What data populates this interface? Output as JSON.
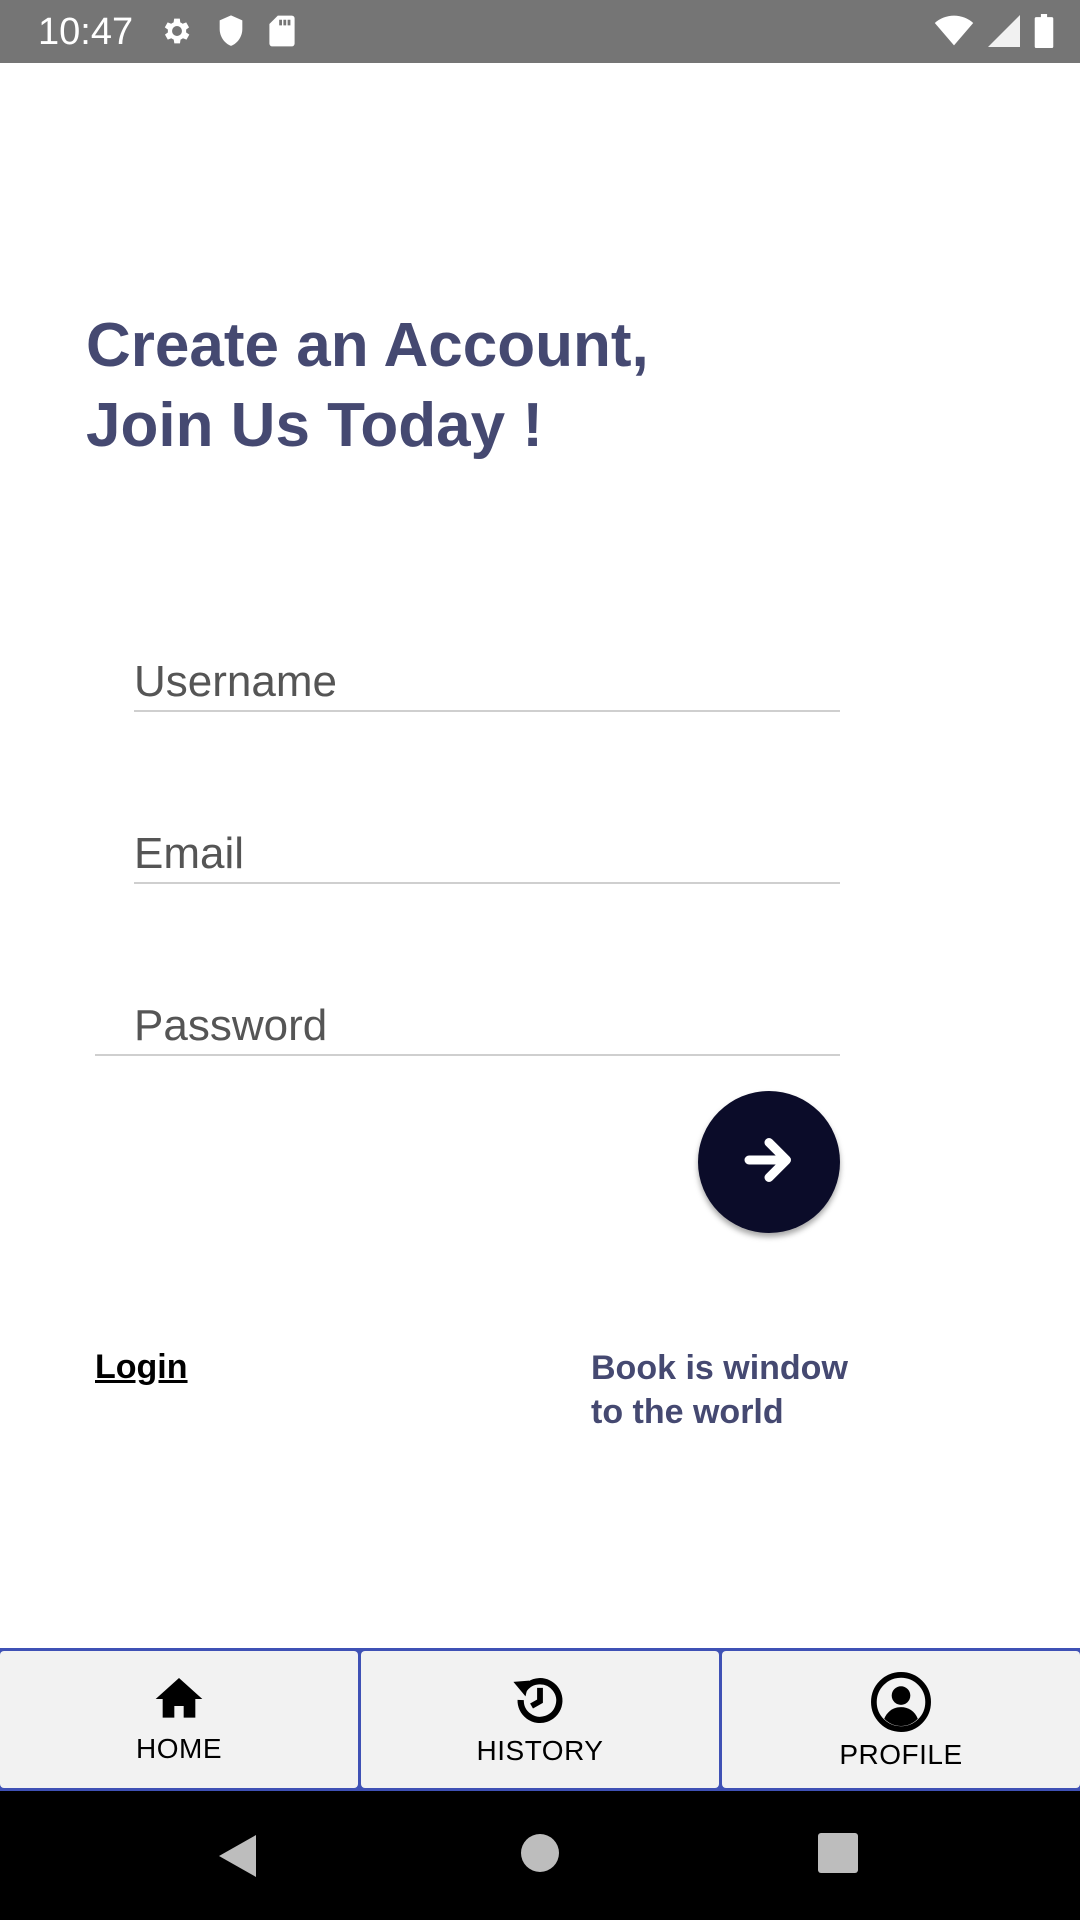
{
  "status_bar": {
    "time": "10:47",
    "left_icons": [
      "gear-icon",
      "shield-icon",
      "sd-card-icon"
    ],
    "right_icons": [
      "wifi-icon",
      "signal-icon",
      "battery-icon"
    ]
  },
  "heading": {
    "line1": "Create an Account,",
    "line2": "Join Us Today !"
  },
  "form": {
    "username_placeholder": "Username",
    "email_placeholder": "Email",
    "password_placeholder": "Password",
    "submit_icon": "arrow-right-icon"
  },
  "login_label": "Login",
  "tagline": {
    "line1": "Book is window",
    "line2": "to the world"
  },
  "bottom_nav": {
    "items": [
      {
        "label": "HOME",
        "icon": "home-icon"
      },
      {
        "label": "HISTORY",
        "icon": "history-icon"
      },
      {
        "label": "PROFILE",
        "icon": "profile-icon"
      }
    ]
  },
  "colors": {
    "heading": "#454971",
    "fab": "#0b0c29",
    "nav_accent": "#3f51b5",
    "status_bar": "#757575"
  }
}
